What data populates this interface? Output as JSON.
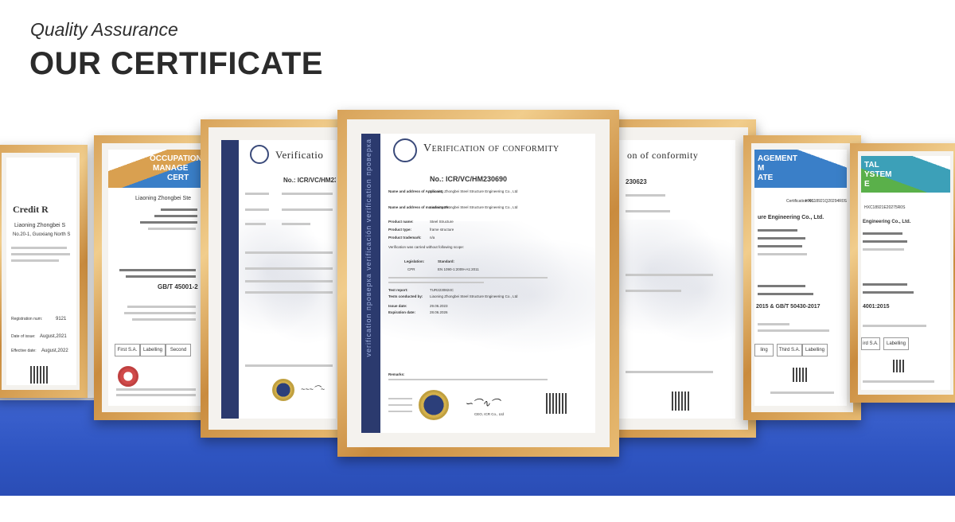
{
  "header": {
    "eyebrow": "Quality Assurance",
    "title": "OUR CERTIFICATE"
  },
  "colors": {
    "band": "#3358c6",
    "frame_gold": "#d8a35a",
    "stripe_navy": "#2b3a6e"
  },
  "certificates": {
    "credit": {
      "heading": "Credit R",
      "company": "Liaoning Zhongbei S",
      "address": "No.20-1, Guoxiang North S",
      "date_issue_label": "Date of issue:",
      "date_issue": "August,2021",
      "date_effective_label": "Effective date:",
      "date_effective": "August,2022",
      "reg_label": "Registration num:",
      "reg_no": "9121"
    },
    "ohs": {
      "banner1": "OCCUPATIONAL",
      "banner2": "MANAGE",
      "banner3": "CERT",
      "company": "Liaoning Zhongbei Ste",
      "standard": "GB/T 45001-2",
      "cells": [
        "First S.A.",
        "Labelling",
        "Second"
      ]
    },
    "verif_left": {
      "heading": "Verificatio",
      "number": "No.: ICR/VC/HM230"
    },
    "verif_main": {
      "heading": "Verification of conformity",
      "number": "No.: ICR/VC/HM230690",
      "rows": [
        {
          "label": "Name and address of Applicant:",
          "value": "Liaoning Zhongbei Steel Structure Engineering Co., Ltd"
        },
        {
          "label": "Name and address of manufacturer:",
          "value": "Liaoning Zhongbei Steel Structure Engineering Co., Ltd"
        },
        {
          "label": "Product name:",
          "value": "Steel Structure"
        },
        {
          "label": "Product type:",
          "value": "frame structure"
        },
        {
          "label": "Product trademark:",
          "value": "n/a"
        }
      ],
      "scope": "Verification was carried without following scope:",
      "legislation_label": "Legislation:",
      "standard_label": "Standard:",
      "legislation": "CPR",
      "standard": "EN 1090-1:2009+A1:2011",
      "test_report_label": "Test report:",
      "test_report": "TUR2230824C",
      "tests_by_label": "Tests conducted by:",
      "tests_by": "Liaoning Zhongbei Steel Structure Engineering Co., Ltd",
      "issue_date_label": "Issue date:",
      "issue_date": "29.06.2023",
      "expiration_label": "Expiration date:",
      "expiration": "28.06.2026",
      "remarks": "Remarks:",
      "sign_caption": "CEO, ICR Co., Ltd",
      "stripe_text": "verification проверка verificación verification проверка"
    },
    "verif_right": {
      "heading": "on of conformity",
      "number": "230623"
    },
    "env_mgmt": {
      "banner1": "AGEMENT",
      "banner2": "M",
      "banner3": "ATE",
      "cert_no_label": "Certification No.:",
      "cert_no": "HXC18921Q20294R0S",
      "company": "ure Engineering Co., Ltd.",
      "standard": "2015 & GB/T 50430-2017",
      "cells": [
        "ling",
        "Third S.A.",
        "Labelling"
      ]
    },
    "qms": {
      "banner1": "TAL",
      "banner2": "YSTEM",
      "banner3": "E",
      "cert_no": "HXC18921E20275R0S",
      "company": "Engineering Co., Ltd.",
      "standard": "4001:2015",
      "cells": [
        "ird S.A.",
        "Labelling"
      ]
    }
  }
}
